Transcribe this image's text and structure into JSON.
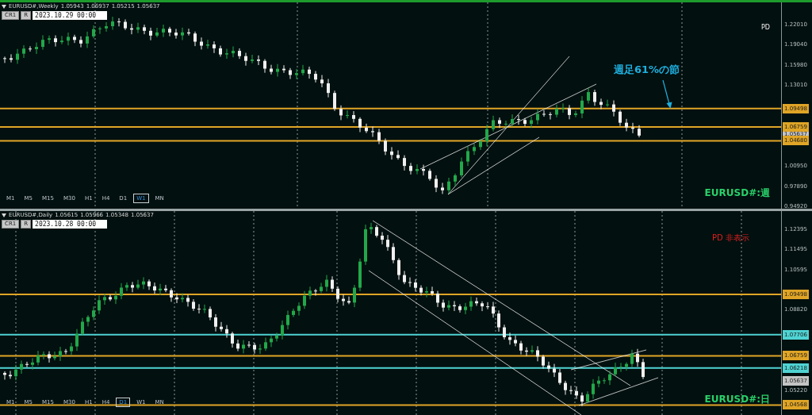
{
  "panels": [
    {
      "header": {
        "symbol": "EURUSD#,Weekly",
        "ohlc": [
          "1.05943",
          "1.06937",
          "1.05215",
          "1.05637"
        ]
      },
      "buttons": [
        "CR1",
        "R"
      ],
      "date": "2023.10.29 00:00",
      "corner_label": {
        "text": "PD",
        "kind": "normal"
      },
      "chart_label": "EURUSD#:週",
      "annotation": {
        "text": "週足61%の節"
      },
      "price_ticks": [
        "1.22010",
        "1.19040",
        "1.15980",
        "1.13010",
        "1.00950",
        "0.97890",
        "0.94920"
      ],
      "price_lines": [
        {
          "value": "1.09498",
          "color": "#e0a526"
        },
        {
          "value": "1.06759",
          "color": "#e0a526"
        },
        {
          "value": "1.04680",
          "color": "#e0a526"
        }
      ],
      "current_price": "1.05637",
      "timeframes": [
        {
          "label": "M1",
          "selected": false
        },
        {
          "label": "M5",
          "selected": false
        },
        {
          "label": "M15",
          "selected": false
        },
        {
          "label": "M30",
          "selected": false
        },
        {
          "label": "H1",
          "selected": false
        },
        {
          "label": "H4",
          "selected": false
        },
        {
          "label": "D1",
          "selected": false
        },
        {
          "label": "W1",
          "selected": true
        },
        {
          "label": "MN",
          "selected": false
        }
      ]
    },
    {
      "header": {
        "symbol": "EURUSD#,Daily",
        "ohlc": [
          "1.05615",
          "1.05966",
          "1.05348",
          "1.05637"
        ]
      },
      "buttons": [
        "CR1",
        "R"
      ],
      "date": "2023.10.28 00:00",
      "corner_label": {
        "text": "PD 非表示",
        "kind": "alert"
      },
      "chart_label": "EURUSD#:日",
      "price_ticks": [
        "1.12395",
        "1.11495",
        "1.10595",
        "1.08820",
        "1.05220"
      ],
      "price_lines": [
        {
          "value": "1.09498",
          "color": "#e0a526"
        },
        {
          "value": "1.07706",
          "color": "#4fd3d3"
        },
        {
          "value": "1.06759",
          "color": "#e0a526"
        },
        {
          "value": "1.06218",
          "color": "#4fd3d3"
        },
        {
          "value": "1.04568",
          "color": "#e0a526"
        }
      ],
      "current_price": "1.05637",
      "timeframes": [
        {
          "label": "M1",
          "selected": false
        },
        {
          "label": "M5",
          "selected": false
        },
        {
          "label": "M15",
          "selected": false
        },
        {
          "label": "M30",
          "selected": false
        },
        {
          "label": "H1",
          "selected": false
        },
        {
          "label": "H4",
          "selected": false
        },
        {
          "label": "D1",
          "selected": true
        },
        {
          "label": "W1",
          "selected": false
        },
        {
          "label": "MN",
          "selected": false
        }
      ]
    }
  ]
}
